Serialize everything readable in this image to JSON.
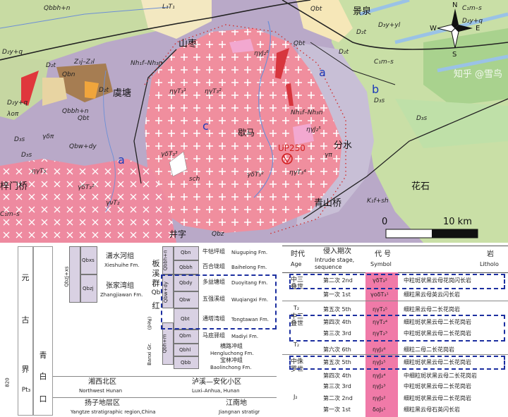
{
  "map": {
    "place_names": {
      "shanzao": "山枣",
      "jingquan": "景泉",
      "gutang": "虞塘",
      "xiema": "歇马",
      "fenshui": "分水",
      "qingshanqiao": "青山桥",
      "huashi": "花石",
      "zishumenqiao": "梓门桥",
      "jingzi": "井字"
    },
    "sample": "UP250",
    "zone_labels": {
      "a1": "a",
      "a2": "a",
      "b": "b",
      "c": "c"
    },
    "scale_text": {
      "zero": "0",
      "ten": "10 km"
    },
    "compass": {
      "n": "N",
      "s": "S",
      "w": "W",
      "e": "E"
    },
    "watermark": "知乎 @雪鸟",
    "unit_labels": [
      "Qbbh+n",
      "Qbt",
      "Qbt",
      "D₂y+q",
      "D₂t",
      "Qbn",
      "Z₁j–Z₂l",
      "Nh₁f–Nh₃n",
      "D₂t",
      "Qbbh+n",
      "λoπ",
      "γδπ",
      "Qbw+dy",
      "D₃s",
      "ηγT₃",
      "D₃s",
      "Nh₁f–Nh₃n",
      "K₁f+sh",
      "C₁m–s",
      "D₂t",
      "D₃y+yl",
      "D₃s",
      "ηγT₃²",
      "γδT₃³",
      "γδT₃²",
      "ηγT₃¹",
      "ηγT₃⁴",
      "ηγJ₂⁵",
      "γπ",
      "sch",
      "Qbz",
      "C₁m–s",
      "D₂y+q",
      "C₁m–s",
      "D₂t",
      "L₁T₁",
      "ηγJ₂⁶",
      "γδT₃²",
      "Qbt",
      "D₃s",
      "D₂y+q",
      "γνT₂"
    ]
  },
  "stratigraphy": {
    "col_age": [
      "元",
      "古",
      "界",
      "Pt₃"
    ],
    "col_sub": [
      "青",
      "白",
      "口"
    ],
    "code_left": "820",
    "left_groups": [
      {
        "code": "Qbxs",
        "cn": "潇水河组",
        "en": "Xieshuihe Fm."
      },
      {
        "code": "Qbzj",
        "cn": "张家湾组",
        "en": "Zhangjiawan Fm."
      }
    ],
    "left_group_code": "Qbzj+xs",
    "banxi_label": [
      "板",
      "溪",
      "群",
      "Qb"
    ],
    "banxi_red": [
      "红",
      "(Red)"
    ],
    "banxi_gr": "Banxi Gr.",
    "group_codes": [
      "Qbbh+n",
      "Qbw+dy",
      "Qbh+m"
    ],
    "formations": [
      {
        "code": "Qbn",
        "cn": "牛牯坪组",
        "en": "Niuguping Fm."
      },
      {
        "code": "Qbbh",
        "cn": "百合垅组",
        "en": "Baihelong Fm."
      },
      {
        "code": "Qbdy",
        "cn": "多益塘组",
        "en": "Duoyitang Fm."
      },
      {
        "code": "Qbw",
        "cn": "五强溪组",
        "en": "Wuqiangxi Fm."
      },
      {
        "code": "Qbt",
        "cn": "通塔湾组",
        "en": "Tongtawan Fm."
      },
      {
        "code": "Qbm",
        "cn": "马底驿组",
        "en": "Madiyi Fm."
      },
      {
        "code": "Qbhl",
        "cn": "横路冲组",
        "en": "Hengluchong Fm."
      },
      {
        "code": "Qbb",
        "cn": "宝林冲组",
        "en": "Baolinchong Fm."
      }
    ],
    "regions": {
      "nw_cn": "湘西北区",
      "nw_en": "Northwest Hunan",
      "la_cn": "泸溪—安化小区",
      "la_en": "Luxi–Anhua, Hunan",
      "yz_cn": "扬子地层区",
      "yz_en": "Yangtze stratigraphic region,China",
      "jn_cn": "江南地",
      "jn_en": "Jiangnan stratigr"
    }
  },
  "intrusion": {
    "headers": {
      "age_cn": "时代",
      "age_en": "Age",
      "stage_cn": "侵入期次",
      "stage_en": "Intrude stage,",
      "stage_en2": "sequence",
      "sym_cn": "代 号",
      "sym_en": "Symbol",
      "lith_cn": "岩",
      "lith_en": "Litholo"
    },
    "ages": [
      {
        "cn": "中三叠世",
        "code": "T₂"
      },
      {
        "cn": "中三叠世",
        "code": "T₂"
      },
      {
        "cn": "中侏罗世",
        "code": "J₂"
      }
    ],
    "rows": [
      {
        "stage": "第二次 2nd",
        "symbol": "γδT₃²",
        "lith": "中粒斑状黑云母花岗闪长岩"
      },
      {
        "stage": "第一次 1st",
        "symbol": "γoδT₃¹",
        "lith": "细粒黑云母英云闪长岩"
      },
      {
        "stage": "第五次 5th",
        "symbol": "ηγT₂⁵",
        "lith": "细粒黑云母二长花岗岩"
      },
      {
        "stage": "第四次 4th",
        "symbol": "ηγT₂⁴",
        "lith": "细粒斑状黑云母二长花岗岩"
      },
      {
        "stage": "第三次 3rd",
        "symbol": "ηγT₂³",
        "lith": "中粒斑状黑云母二长花岗岩"
      },
      {
        "stage": "第六次 6th",
        "symbol": "ηγJ₂⁶",
        "lith": "细粒二母二长花岗岩"
      },
      {
        "stage": "第五次 5th",
        "symbol": "ηγJ₂⁵",
        "lith": "细粒斑状黑云母二长花岗岩"
      },
      {
        "stage": "第四次 4th",
        "symbol": "ηγJ₂⁴",
        "lith": "中细粒斑状黑云母二长花岗岩"
      },
      {
        "stage": "第三次 3rd",
        "symbol": "ηγJ₂³",
        "lith": "中粒斑状黑云母二长花岗岩"
      },
      {
        "stage": "第二次 2nd",
        "symbol": "ηγJ₂²",
        "lith": "细粒斑状黑云母二长花岗岩"
      },
      {
        "stage": "第一次 1st",
        "symbol": "δoJ₂¹",
        "lith": "细粒黑云母石英闪长岩"
      }
    ]
  }
}
